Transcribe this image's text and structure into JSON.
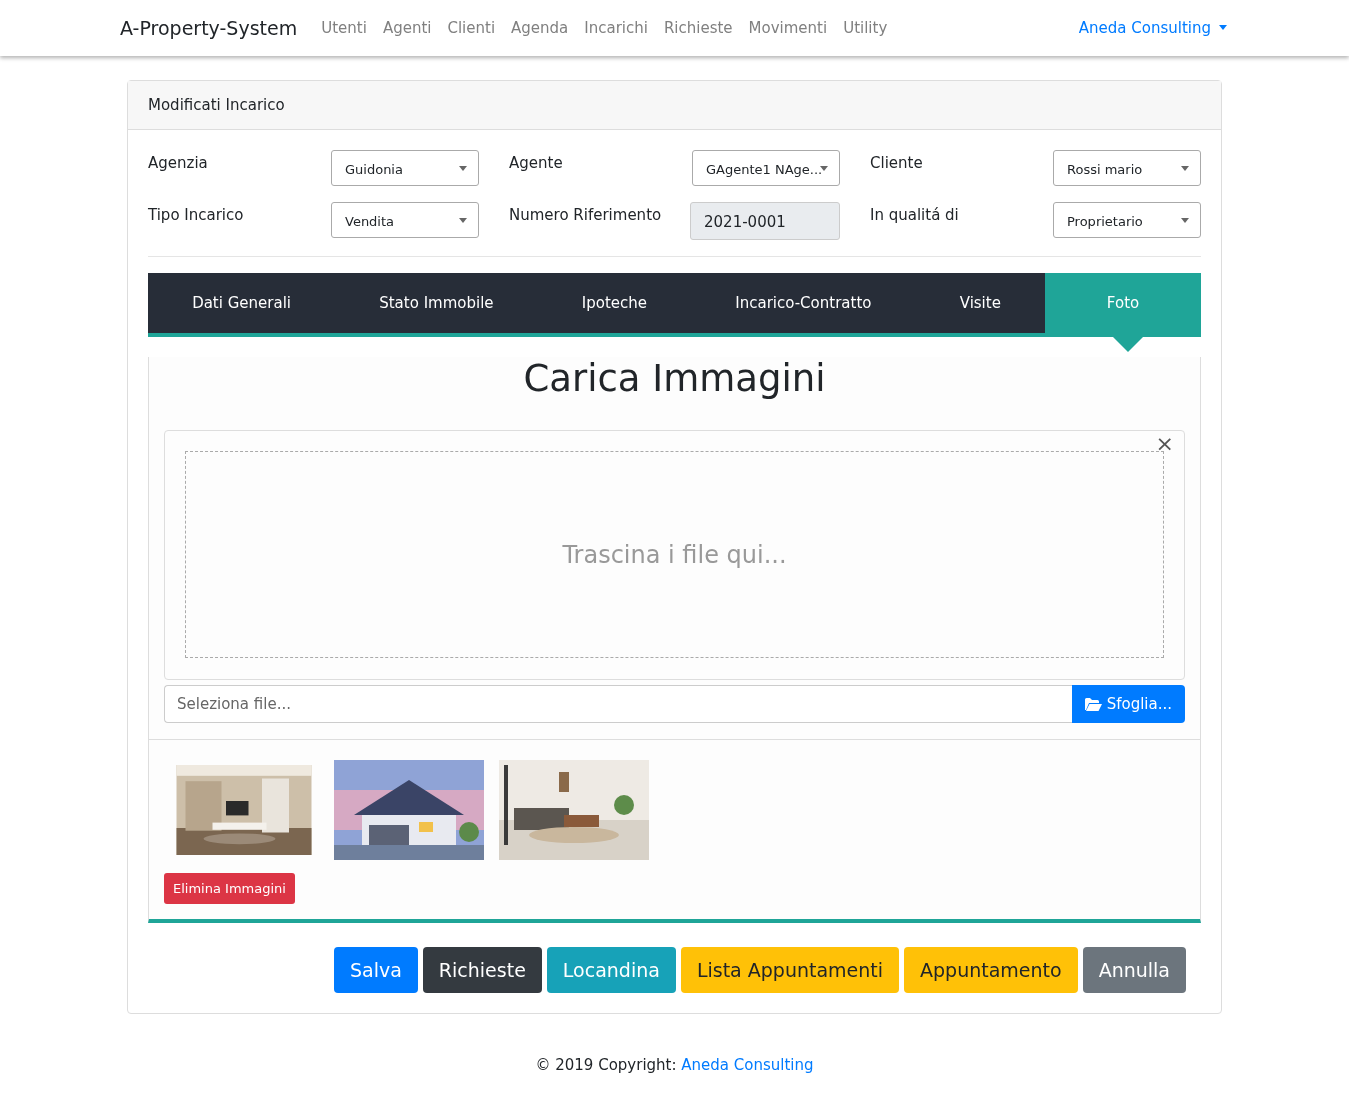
{
  "navbar": {
    "brand": "A-Property-System",
    "items": [
      "Utenti",
      "Agenti",
      "Clienti",
      "Agenda",
      "Incarichi",
      "Richieste",
      "Movimenti",
      "Utility"
    ],
    "account": "Aneda Consulting"
  },
  "card": {
    "title": "Modificati Incarico"
  },
  "form": [
    {
      "label": "Agenzia",
      "kind": "select",
      "value": "Guidonia"
    },
    {
      "label": "Agente",
      "kind": "select",
      "value": "GAgente1 NAge..."
    },
    {
      "label": "Cliente",
      "kind": "select",
      "value": "Rossi mario"
    },
    {
      "label": "Tipo Incarico",
      "kind": "select",
      "value": "Vendita"
    },
    {
      "label": "Numero Riferimento",
      "kind": "readonly",
      "value": "2021-0001"
    },
    {
      "label": "In qualitá di",
      "kind": "select",
      "value": "Proprietario"
    }
  ],
  "tabs": [
    {
      "label": "Dati Generali",
      "selected": false
    },
    {
      "label": "Stato Immobile",
      "selected": false
    },
    {
      "label": "Ipoteche",
      "selected": false
    },
    {
      "label": "Incarico-Contratto",
      "selected": false
    },
    {
      "label": "Visite",
      "selected": false
    },
    {
      "label": "Foto",
      "selected": true
    }
  ],
  "upload": {
    "title": "Carica Immagini",
    "drop_text": "Trascina i file qui...",
    "close": "×",
    "file_placeholder": "Seleziona file...",
    "browse": "Sfoglia..."
  },
  "delete_button": "Elimina Immagini",
  "buttons": [
    {
      "label": "Salva",
      "kind": "primary"
    },
    {
      "label": "Richieste",
      "kind": "dark"
    },
    {
      "label": "Locandina",
      "kind": "info"
    },
    {
      "label": "Lista Appuntamenti",
      "kind": "warning"
    },
    {
      "label": "Appuntamento",
      "kind": "warning"
    },
    {
      "label": "Annulla",
      "kind": "secondary"
    }
  ],
  "footer": {
    "text": "© 2019 Copyright:",
    "link": "Aneda Consulting"
  }
}
